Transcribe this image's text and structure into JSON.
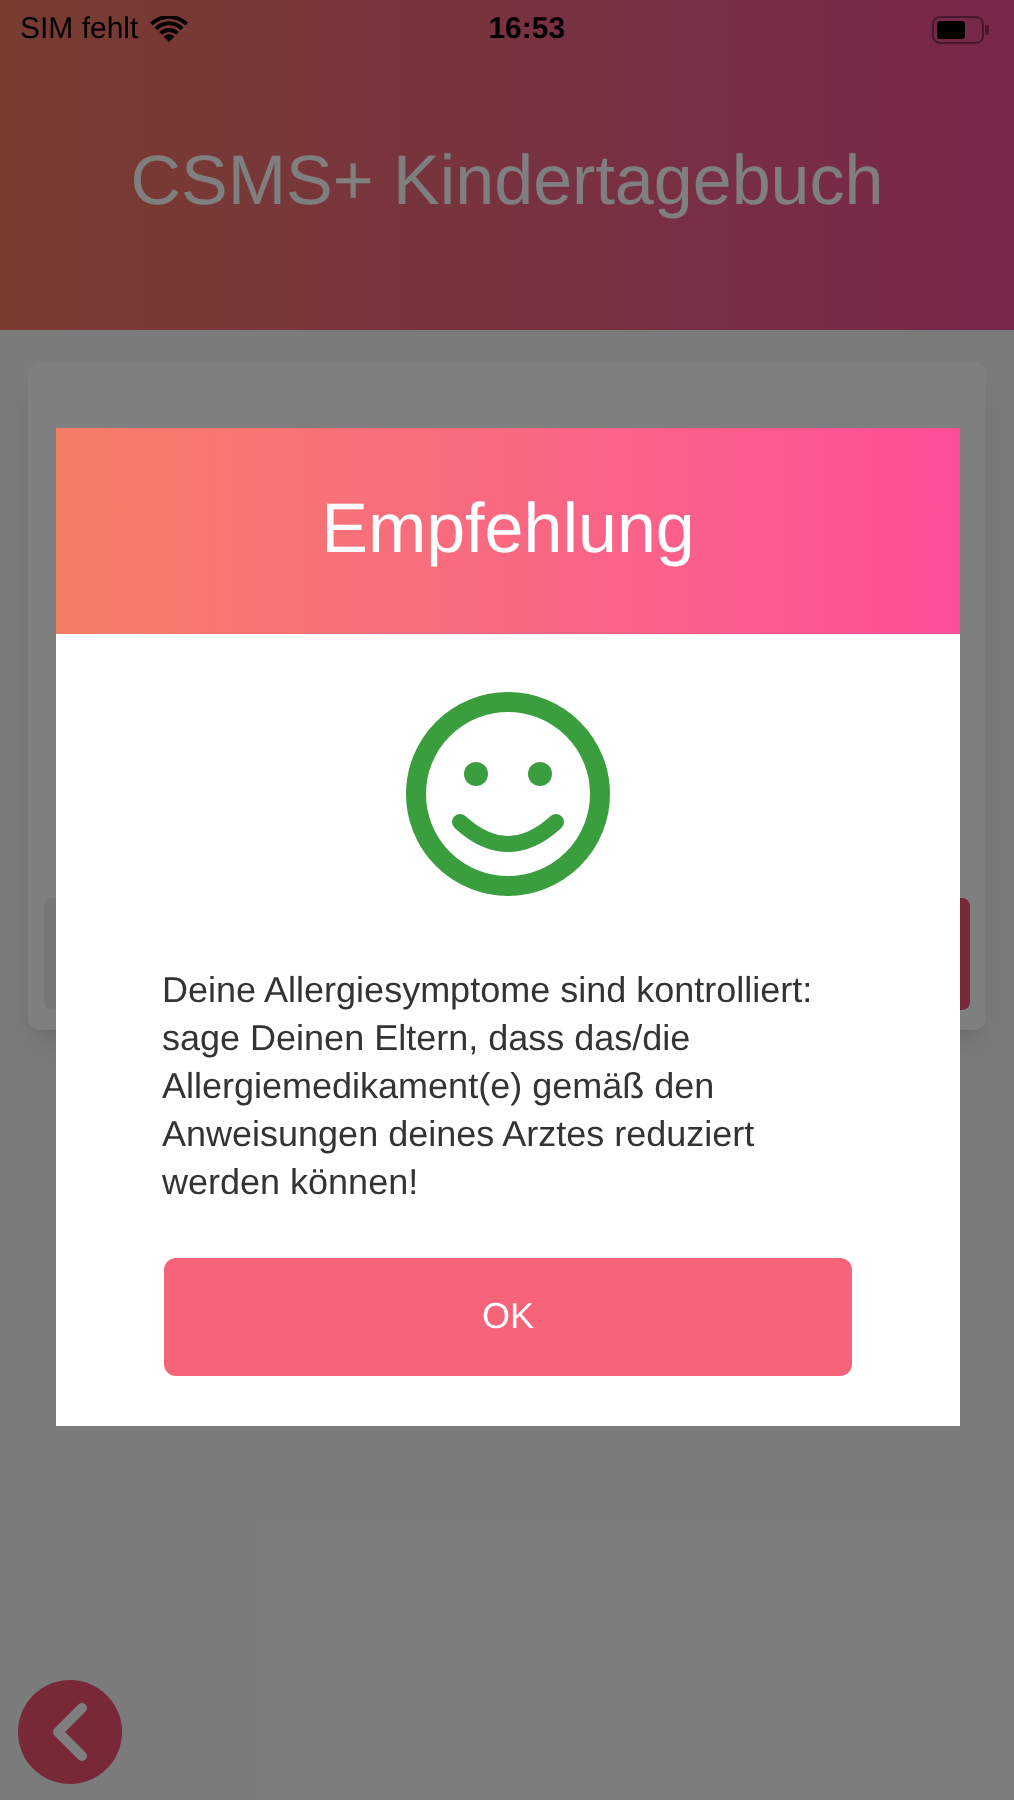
{
  "status_bar": {
    "carrier": "SIM fehlt",
    "time": "16:53"
  },
  "header": {
    "title": "CSMS+ Kindertagebuch"
  },
  "dialog": {
    "title": "Empfehlung",
    "message": "Deine Allergiesymptome sind kontrolliert: sage Deinen Eltern, dass das/die Allergiemedikament(e) gemäß den Anweisungen deines Arztes reduziert werden können!",
    "button": "OK"
  }
}
